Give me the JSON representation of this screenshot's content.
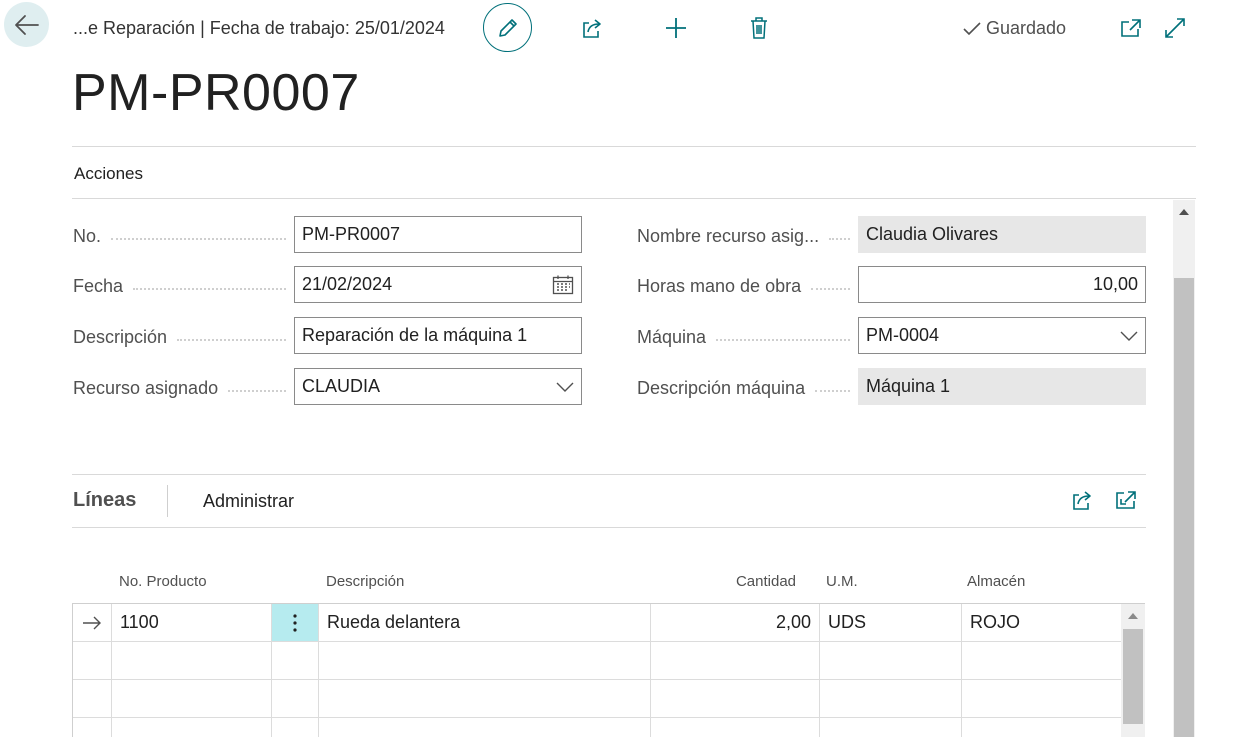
{
  "header": {
    "breadcrumb": "...e Reparación | Fecha de trabajo: 25/01/2024",
    "saved_label": "Guardado",
    "icons": [
      "arrow-left-icon",
      "pencil-icon",
      "share-icon",
      "plus-icon",
      "trash-icon",
      "check-icon",
      "open-new-window-icon",
      "expand-icon"
    ]
  },
  "page": {
    "title": "PM-PR0007",
    "actions_label": "Acciones"
  },
  "form": {
    "no": {
      "label": "No.",
      "value": "PM-PR0007"
    },
    "fecha": {
      "label": "Fecha",
      "value": "21/02/2024"
    },
    "descripcion": {
      "label": "Descripción",
      "value": "Reparación de la máquina 1"
    },
    "recurso": {
      "label": "Recurso asignado",
      "value": "CLAUDIA"
    },
    "nombre_recurso": {
      "label": "Nombre recurso asig...",
      "value": "Claudia Olivares"
    },
    "horas": {
      "label": "Horas mano de obra",
      "value": "10,00"
    },
    "maquina": {
      "label": "Máquina",
      "value": "PM-0004"
    },
    "desc_maquina": {
      "label": "Descripción máquina",
      "value": "Máquina 1"
    }
  },
  "lines": {
    "title": "Líneas",
    "manage_label": "Administrar",
    "columns": {
      "producto": "No. Producto",
      "descripcion": "Descripción",
      "cantidad": "Cantidad",
      "um": "U.M.",
      "almacen": "Almacén"
    },
    "rows": [
      {
        "producto": "1100",
        "descripcion": "Rueda delantera",
        "cantidad": "2,00",
        "um": "UDS",
        "almacen": "ROJO"
      },
      {
        "producto": "",
        "descripcion": "",
        "cantidad": "",
        "um": "",
        "almacen": ""
      },
      {
        "producto": "",
        "descripcion": "",
        "cantidad": "",
        "um": "",
        "almacen": ""
      },
      {
        "producto": "",
        "descripcion": "",
        "cantidad": "",
        "um": "",
        "almacen": ""
      }
    ]
  },
  "colors": {
    "accent": "#00707a",
    "back_button_bg": "#dfeef0",
    "selected_cell": "#b6ebef",
    "readonly_field": "#e7e7e7"
  }
}
